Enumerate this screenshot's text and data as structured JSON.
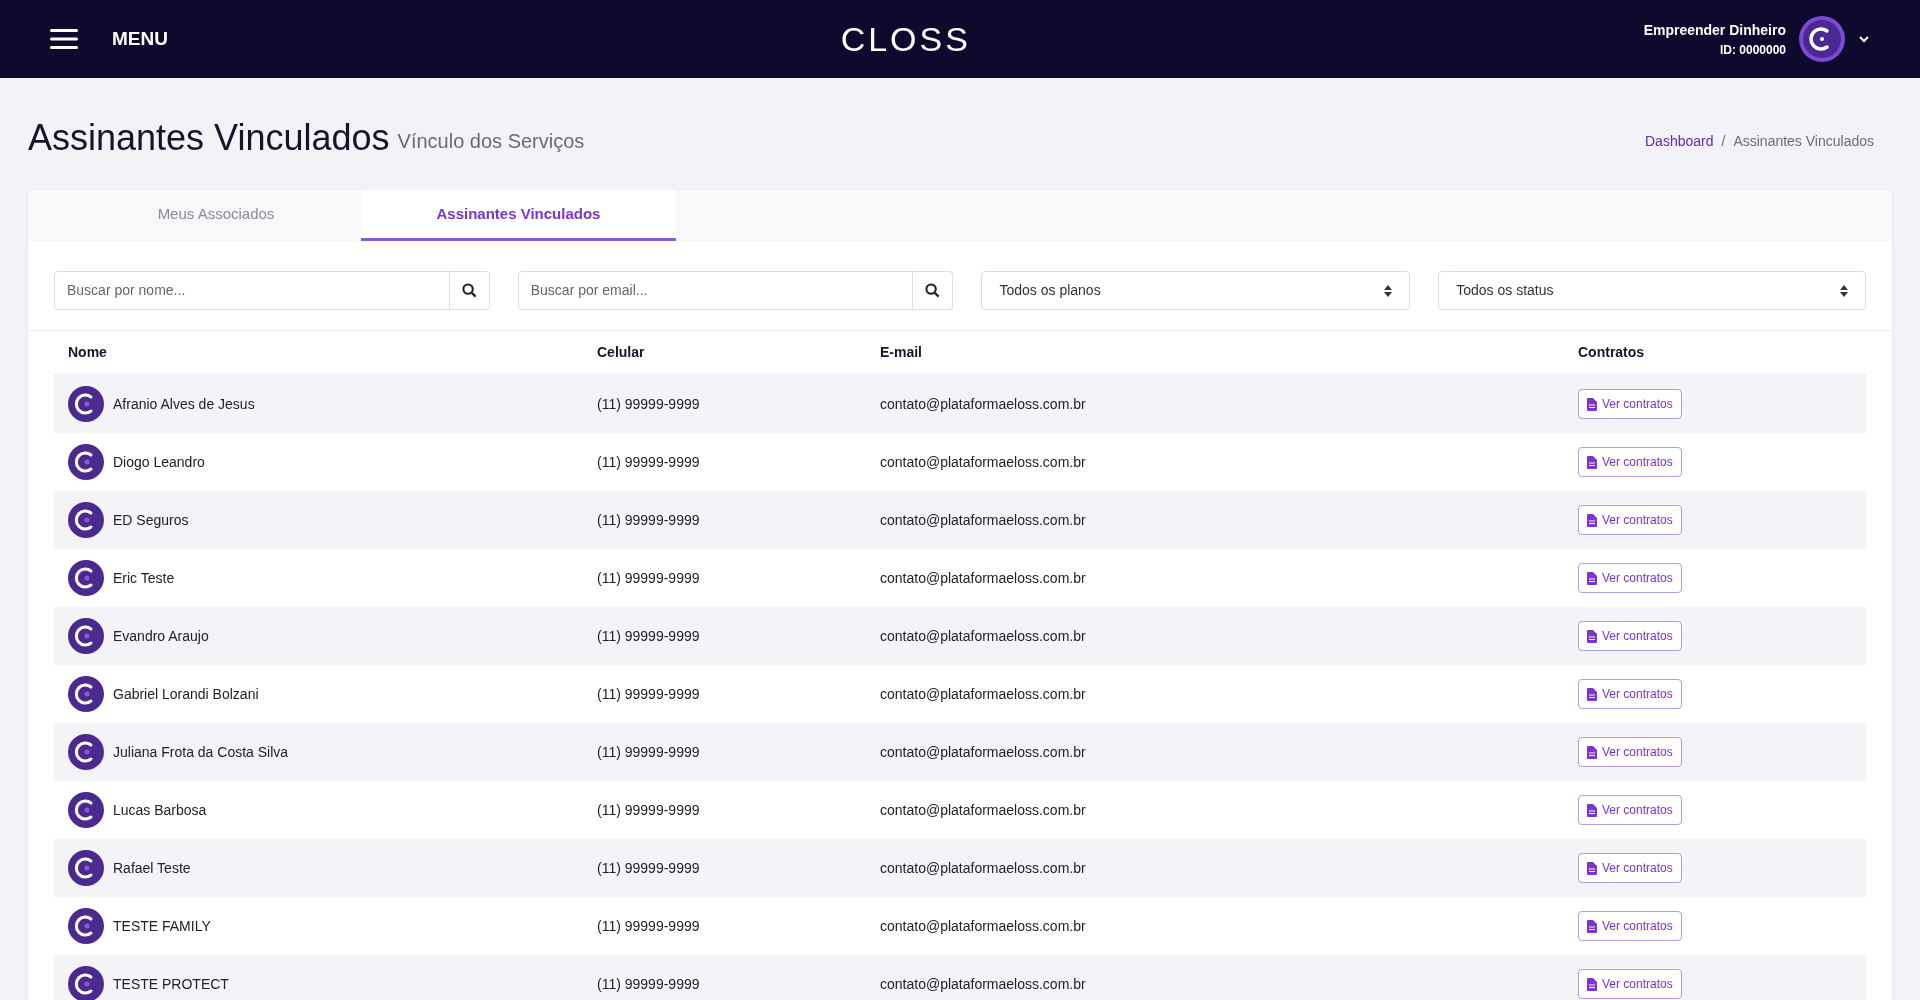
{
  "header": {
    "menu_label": "MENU",
    "logo": "CLOSS",
    "user_name": "Empreender Dinheiro",
    "user_id": "ID: 0000000"
  },
  "page": {
    "title": "Assinantes Vinculados",
    "subtitle": "Vínculo dos Serviços"
  },
  "breadcrumb": [
    {
      "label": "Dashboard",
      "link": true
    },
    {
      "label": "/",
      "link": false
    },
    {
      "label": "Assinantes Vinculados",
      "link": false
    }
  ],
  "tabs": [
    {
      "label": "Meus Associados",
      "selected": false
    },
    {
      "label": "Assinantes Vinculados",
      "selected": true
    }
  ],
  "filters": {
    "name_search": {
      "placeholder": "Buscar por nome..."
    },
    "email_search": {
      "placeholder": "Buscar por email..."
    },
    "plan_select": "Todos os planos",
    "status_select": "Todos os status"
  },
  "table": {
    "columns": [
      "Nome",
      "Celular",
      "E-mail",
      "Contratos"
    ],
    "rows": [
      {
        "name": "Afranio Alves de Jesus",
        "phone": "(11) 99999-9999",
        "email": "contato@plataformaeloss.com.br",
        "action": "Ver contratos"
      },
      {
        "name": "Diogo Leandro",
        "phone": "(11) 99999-9999",
        "email": "contato@plataformaeloss.com.br",
        "action": "Ver contratos"
      },
      {
        "name": "ED Seguros",
        "phone": "(11) 99999-9999",
        "email": "contato@plataformaeloss.com.br",
        "action": "Ver contratos"
      },
      {
        "name": "Eric Teste",
        "phone": "(11) 99999-9999",
        "email": "contato@plataformaeloss.com.br",
        "action": "Ver contratos"
      },
      {
        "name": "Evandro Araujo",
        "phone": "(11) 99999-9999",
        "email": "contato@plataformaeloss.com.br",
        "action": "Ver contratos"
      },
      {
        "name": "Gabriel Lorandi Bolzani",
        "phone": "(11) 99999-9999",
        "email": "contato@plataformaeloss.com.br",
        "action": "Ver contratos"
      },
      {
        "name": "Juliana Frota da Costa Silva",
        "phone": "(11) 99999-9999",
        "email": "contato@plataformaeloss.com.br",
        "action": "Ver contratos"
      },
      {
        "name": "Lucas Barbosa",
        "phone": "(11) 99999-9999",
        "email": "contato@plataformaeloss.com.br",
        "action": "Ver contratos"
      },
      {
        "name": "Rafael Teste",
        "phone": "(11) 99999-9999",
        "email": "contato@plataformaeloss.com.br",
        "action": "Ver contratos"
      },
      {
        "name": "TESTE FAMILY",
        "phone": "(11) 99999-9999",
        "email": "contato@plataformaeloss.com.br",
        "action": "Ver contratos"
      },
      {
        "name": "TESTE PROTECT",
        "phone": "(11) 99999-9999",
        "email": "contato@plataformaeloss.com.br",
        "action": "Ver contratos"
      }
    ]
  }
}
